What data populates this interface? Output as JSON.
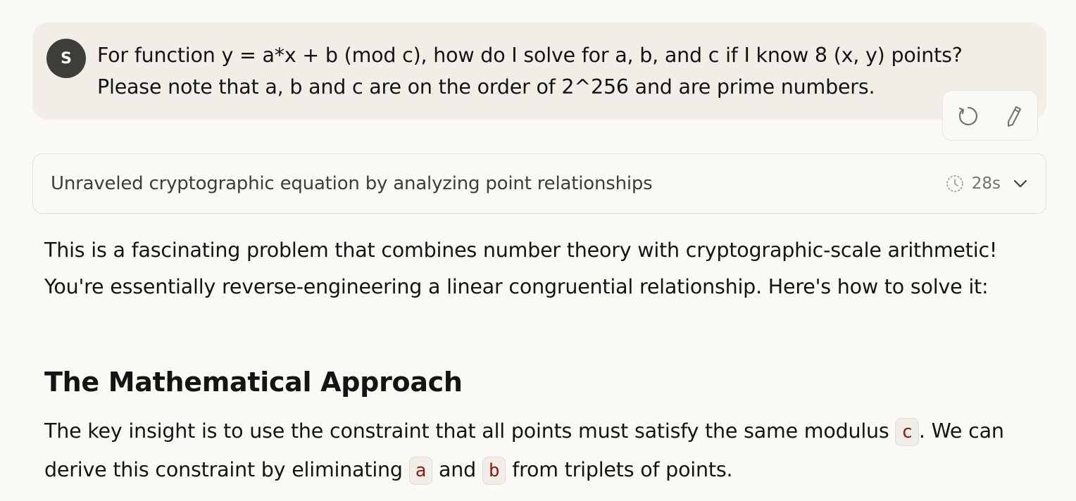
{
  "user_message": {
    "avatar_initial": "S",
    "line1": "For function y = a*x + b (mod c), how do I solve for a, b, and c if I know 8 (x, y) points?",
    "line2": "Please note that a, b and c are on the order of 2^256 and are prime numbers."
  },
  "message_actions": {
    "retry_icon": "retry-icon",
    "edit_icon": "edit-pencil-icon"
  },
  "thinking": {
    "summary": "Unraveled cryptographic equation by analyzing point relationships",
    "duration": "28s",
    "clock_icon": "clock-icon",
    "expand_icon": "chevron-down-icon"
  },
  "response": {
    "intro": "This is a fascinating problem that combines number theory with cryptographic-scale arithmetic! You're essentially reverse-engineering a linear congruential relationship. Here's how to solve it:",
    "heading": "The Mathematical Approach",
    "p2_part1": "The key insight is to use the constraint that all points must satisfy the same modulus",
    "p2_code1": "c",
    "p2_part2": ". We can derive this constraint by eliminating",
    "p2_code2": "a",
    "p2_part3": "and",
    "p2_code3": "b",
    "p2_part4": "from triplets of points."
  },
  "colors": {
    "background": "#faf9f5",
    "user_bubble": "#f0eee6",
    "avatar": "#3d3d3a",
    "inline_code_text": "#8c1c13"
  }
}
